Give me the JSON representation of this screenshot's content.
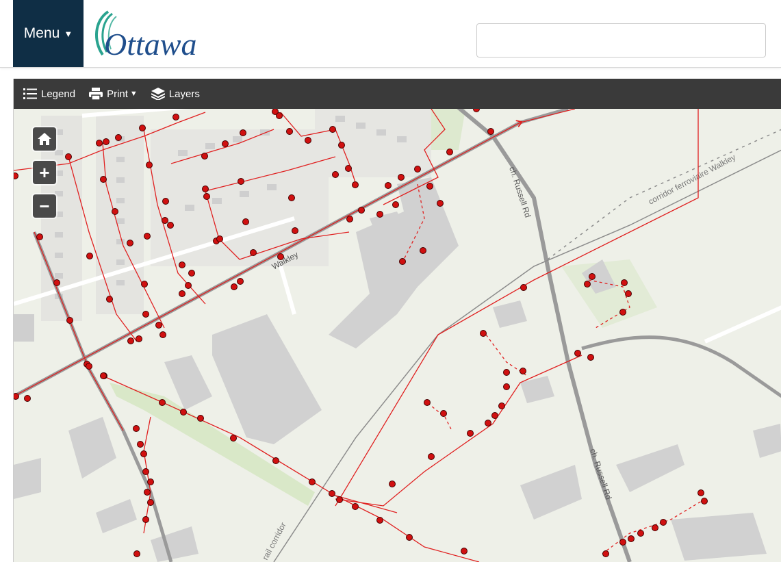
{
  "header": {
    "menu_label": "Menu",
    "logo_text": "Ottawa",
    "search_value": "",
    "search_placeholder": ""
  },
  "toolbar": {
    "legend_label": "Legend",
    "print_label": "Print",
    "layers_label": "Layers"
  },
  "map_controls": {
    "home": "home-icon",
    "zoom_in": "+",
    "zoom_out": "−"
  },
  "map_labels": {
    "russell_road": "ch. Russell Rd",
    "walkley_corridor": "corridor ferroviaire Walkley",
    "rail_corridor": "rail corridor",
    "walkley_road": "Walkley"
  },
  "colors": {
    "menu_bg": "#0f2e45",
    "toolbar_bg": "#3a3a3a",
    "sewer_line": "#e02020",
    "node_fill": "#d01010",
    "map_bg": "#eef0e8",
    "building": "#d3d3d3"
  }
}
